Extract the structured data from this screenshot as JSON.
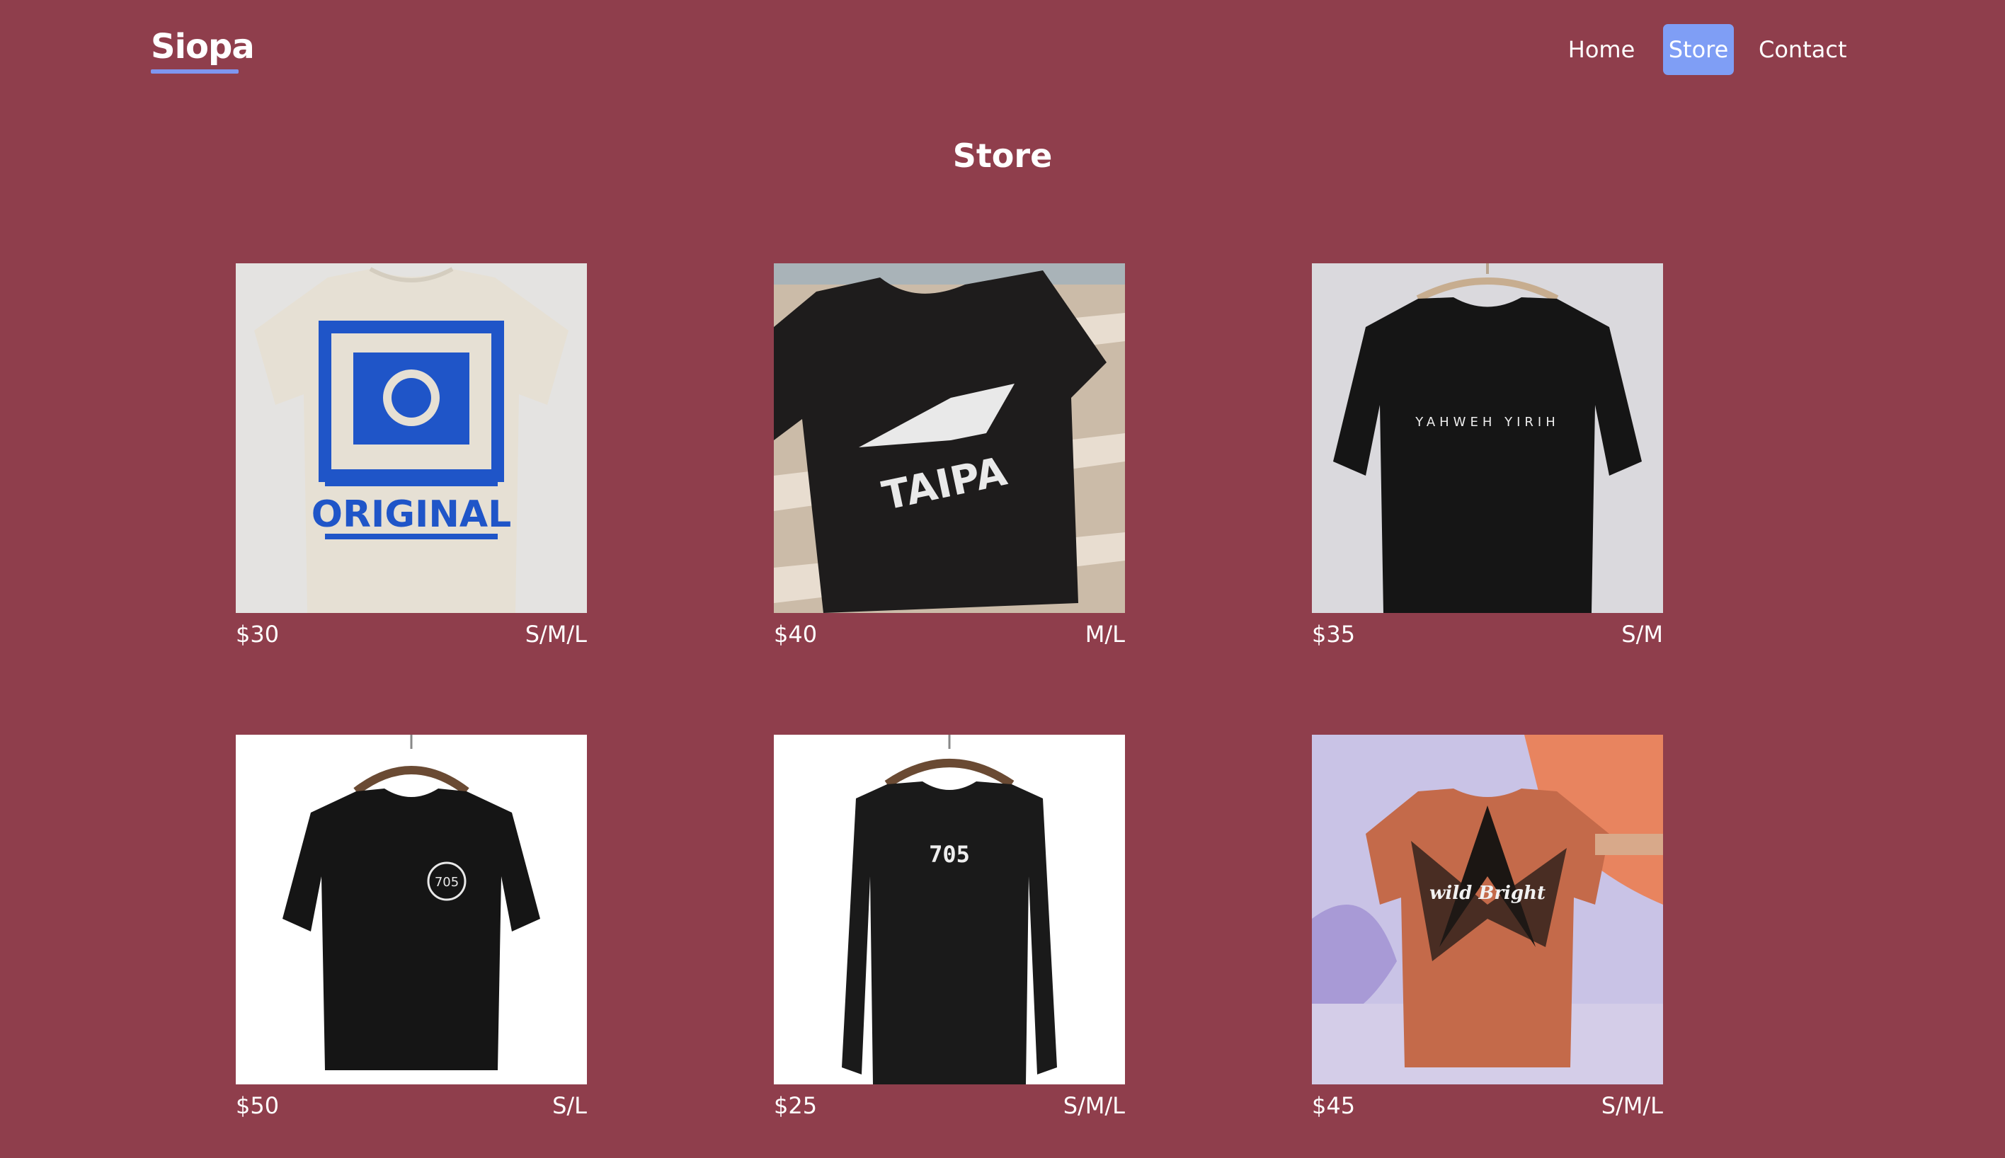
{
  "header": {
    "brand": "Siopa",
    "nav": [
      {
        "label": "Home"
      },
      {
        "label": "Store"
      },
      {
        "label": "Contact"
      }
    ]
  },
  "page": {
    "title": "Store"
  },
  "products": [
    {
      "price": "$30",
      "sizes": "S/M/L",
      "print": "ORIGINAL",
      "icon": "cream-tshirt-icon"
    },
    {
      "price": "$40",
      "sizes": "M/L",
      "print": "TAIPA",
      "icon": "black-tshirt-eagle-icon"
    },
    {
      "price": "$35",
      "sizes": "S/M",
      "print": "YAHWEH YIRIH",
      "icon": "black-tshirt-hanger-icon"
    },
    {
      "price": "$50",
      "sizes": "S/L",
      "print": "705",
      "icon": "black-tshirt-badge-icon"
    },
    {
      "price": "$25",
      "sizes": "S/M/L",
      "print": "705",
      "icon": "black-longsleeve-icon"
    },
    {
      "price": "$45",
      "sizes": "S/M/L",
      "print": "wild Bright",
      "icon": "tiedye-tshirt-icon"
    }
  ],
  "colors": {
    "background": "#8f3e4c",
    "accent": "#7f9ef5"
  }
}
